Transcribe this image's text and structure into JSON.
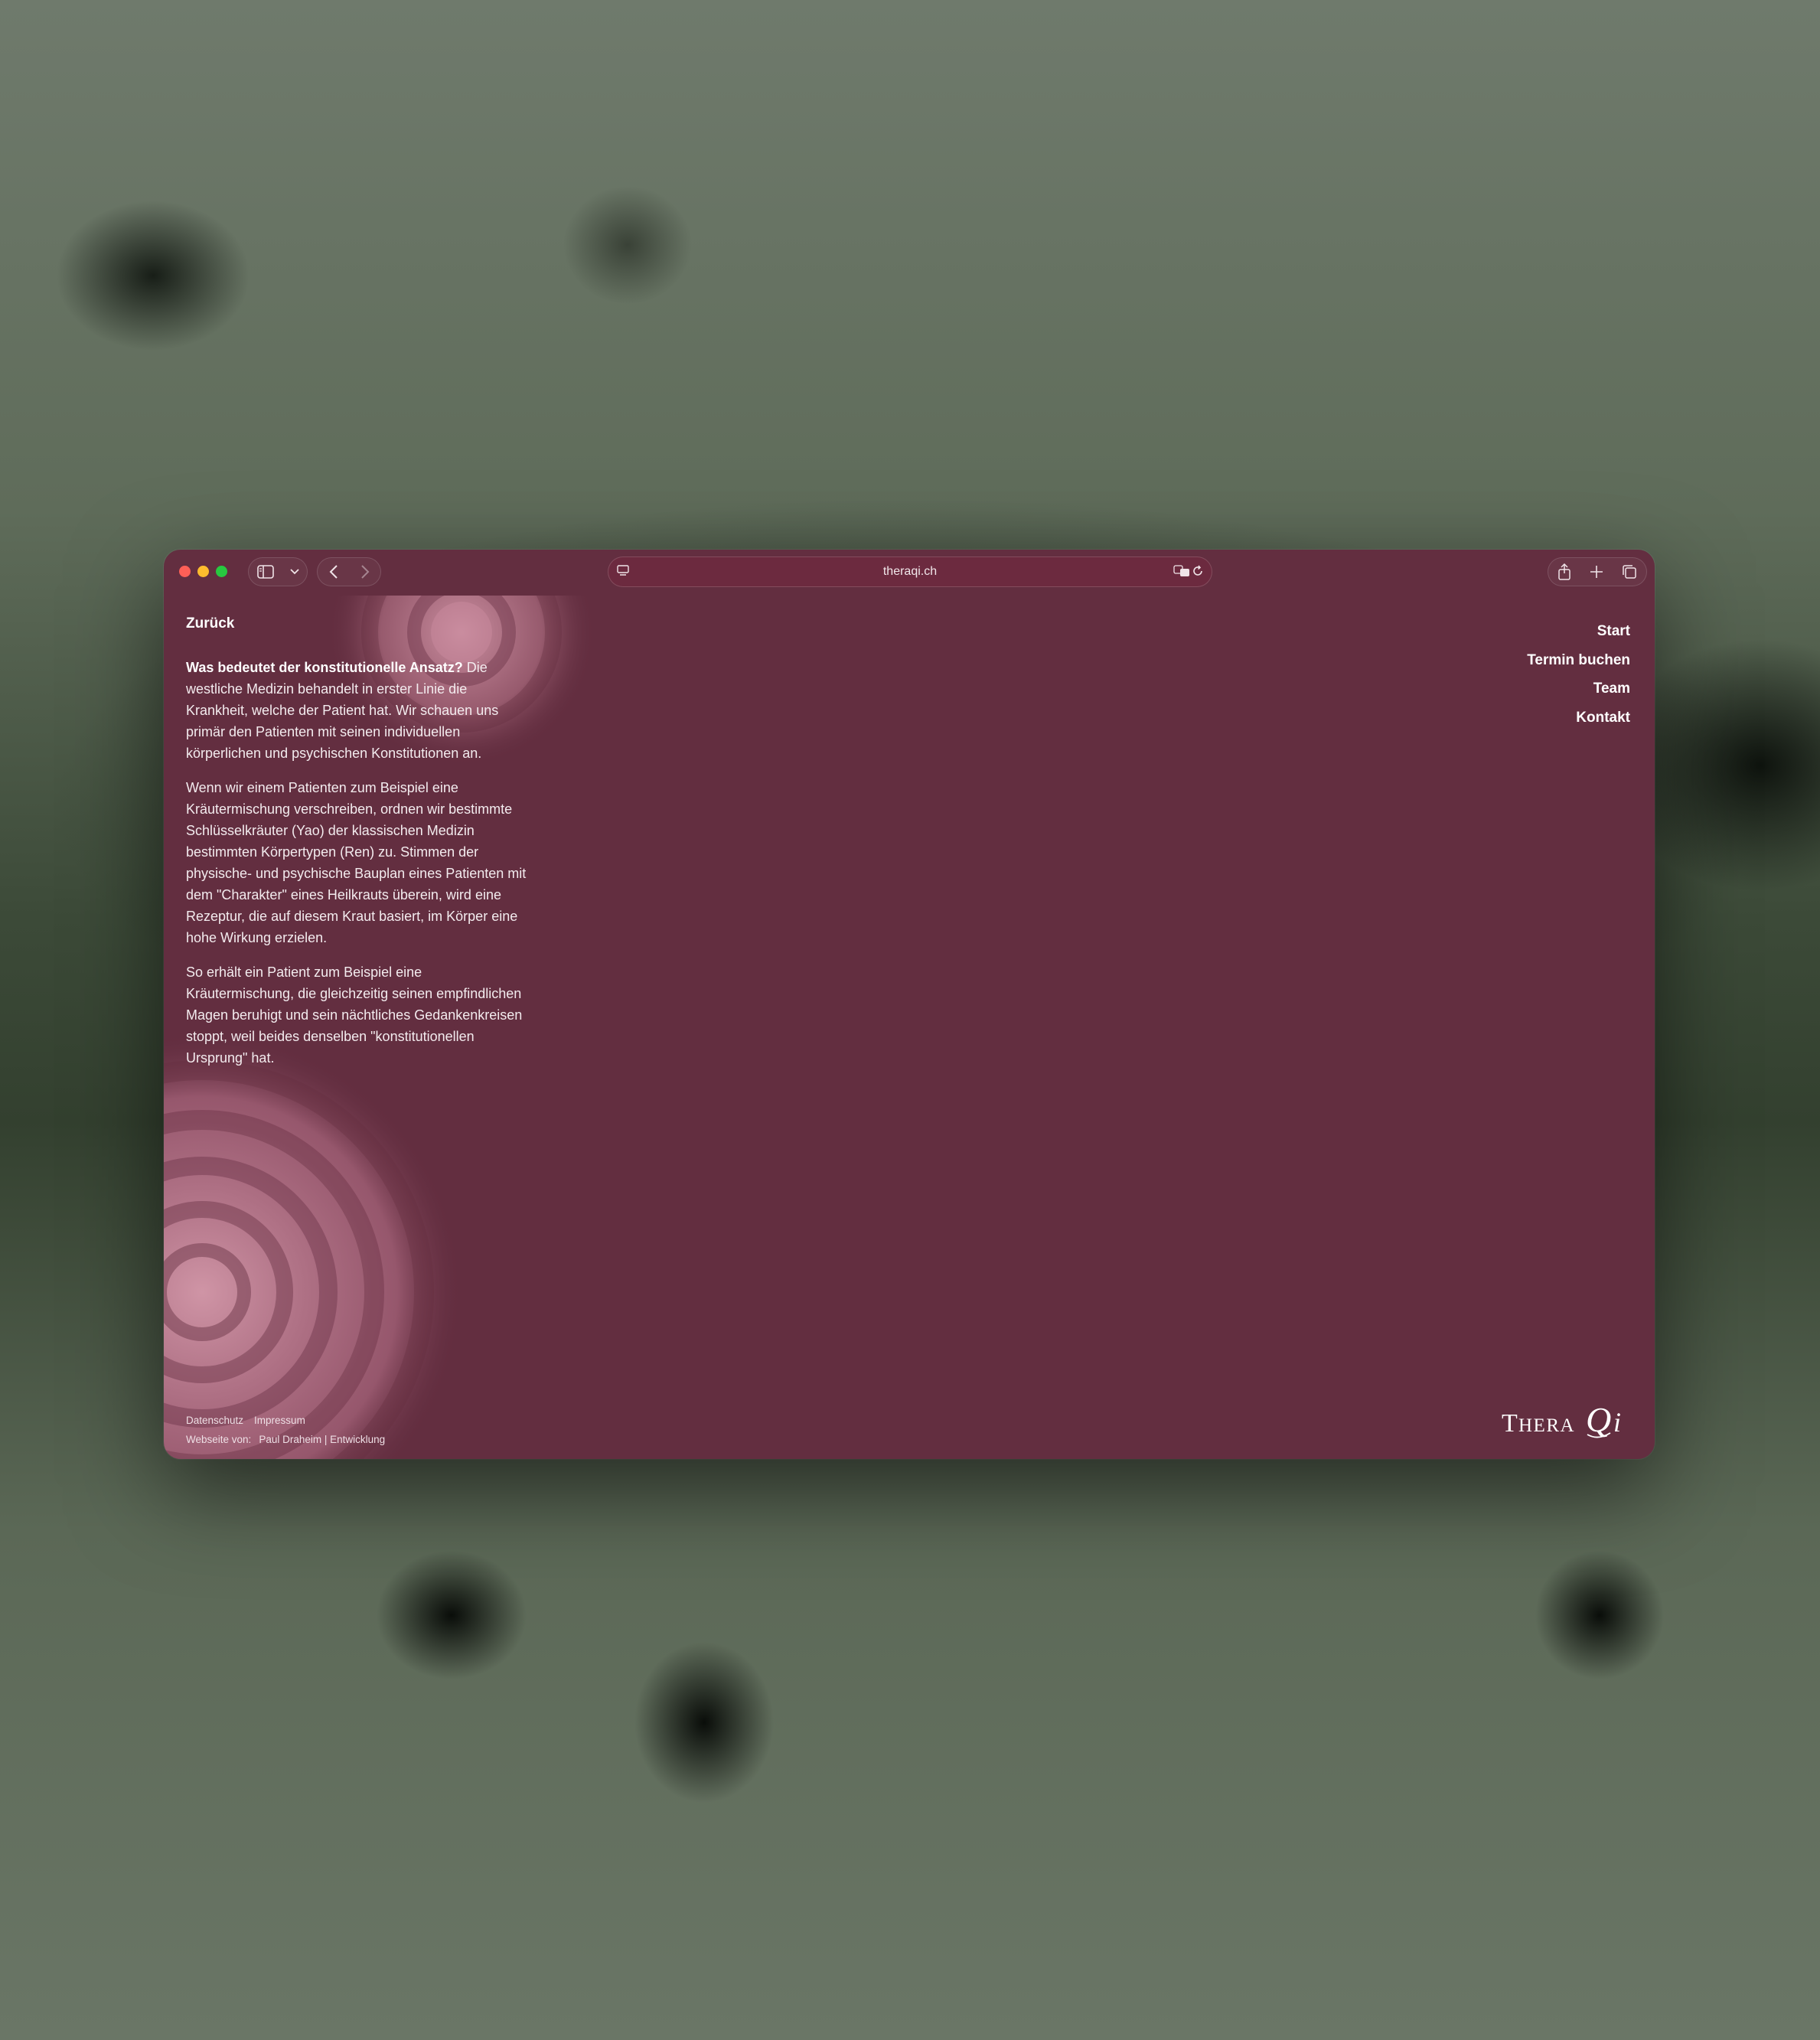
{
  "browser": {
    "url": "theraqi.ch",
    "icons": [
      "sidebar-icon",
      "chevron-down-icon",
      "back-icon",
      "forward-icon",
      "page-menu-icon",
      "translate-icon",
      "reload-icon",
      "share-icon",
      "new-tab-icon",
      "tabs-overview-icon"
    ]
  },
  "page": {
    "back_label": "Zurück",
    "paragraph1_bold": "Was bedeutet der konstitutionelle Ansatz?",
    "paragraph1_text": " Die westliche Medizin behandelt in erster Linie die Krankheit, welche der Patient hat. Wir schauen uns primär den Patienten mit seinen individuellen körperlichen und psychischen Konstitutionen an.",
    "paragraph2": "Wenn wir einem Patienten zum Beispiel eine Kräutermischung verschreiben, ordnen wir bestimmte Schlüsselkräuter (Yao) der klassischen Medizin bestimmten Körpertypen (Ren) zu. Stimmen der physische- und psychische Bauplan eines Patienten mit dem \"Charakter\" eines Heilkrauts überein, wird eine Rezeptur, die auf diesem Kraut basiert, im Körper eine hohe Wirkung erzielen.",
    "paragraph3": "So erhält ein Patient zum Beispiel eine Kräutermischung, die gleichzeitig seinen empfindlichen Magen beruhigt und sein nächtliches Gedankenkreisen stoppt, weil beides denselben \"konstitutionellen Ursprung\" hat."
  },
  "nav": {
    "items": [
      "Start",
      "Termin buchen",
      "Team",
      "Kontakt"
    ]
  },
  "footer": {
    "datenschutz": "Datenschutz",
    "impressum": "Impressum",
    "credit_label": "Webseite von:",
    "credit_link": "Paul Draheim | Entwicklung"
  },
  "logo": {
    "text": "TheraQi"
  },
  "colors": {
    "page_background": "#632e40",
    "ring_color": "#d49aaa",
    "text": "#ffffff"
  }
}
